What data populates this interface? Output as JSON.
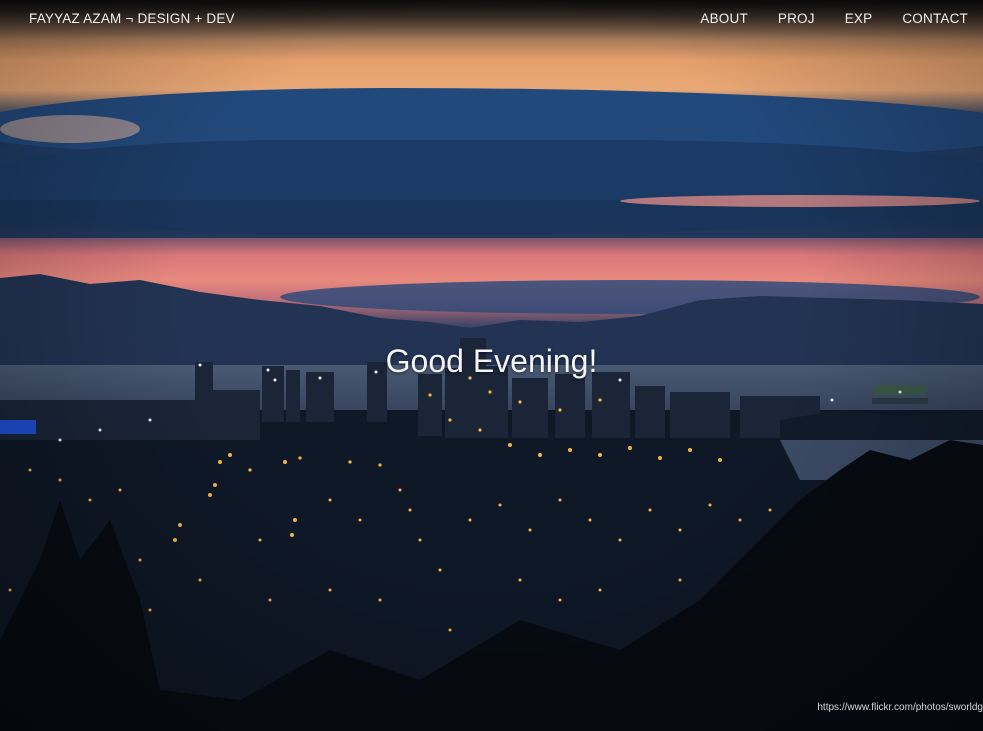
{
  "header": {
    "brand": "FAYYAZ AZAM ¬ DESIGN + DEV",
    "nav": [
      {
        "label": "ABOUT"
      },
      {
        "label": "PROJ"
      },
      {
        "label": "EXP"
      },
      {
        "label": "CONTACT"
      }
    ]
  },
  "hero": {
    "greeting": "Good Evening!",
    "photo_credit": "https://www.flickr.com/photos/sworldg"
  },
  "colors": {
    "nav_text": "#f1f1f1",
    "greeting_text": "#f4f4f4"
  }
}
